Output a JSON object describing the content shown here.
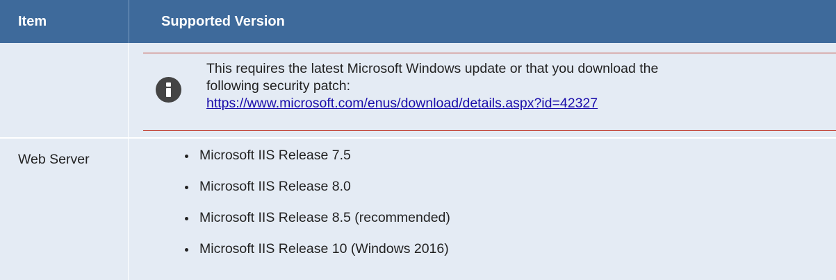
{
  "header": {
    "item_label": "Item",
    "version_label": "Supported Version"
  },
  "note": {
    "icon": "info-icon",
    "line1": "This requires the latest Microsoft Windows update or that you download the",
    "line2": "following security patch:",
    "link": "https://www.microsoft.com/enus/download/details.aspx?id=42327"
  },
  "rows": [
    {
      "item": "Web Server",
      "versions": [
        "Microsoft IIS Release 7.5",
        "Microsoft IIS Release 8.0",
        "Microsoft IIS Release 8.5 (recommended)",
        "Microsoft IIS Release 10 (Windows 2016)"
      ]
    }
  ],
  "colors": {
    "header_bg": "#3e6a9b",
    "row_bg": "#e4ebf4",
    "note_rule": "#c0392b",
    "link": "#1a0dab"
  }
}
